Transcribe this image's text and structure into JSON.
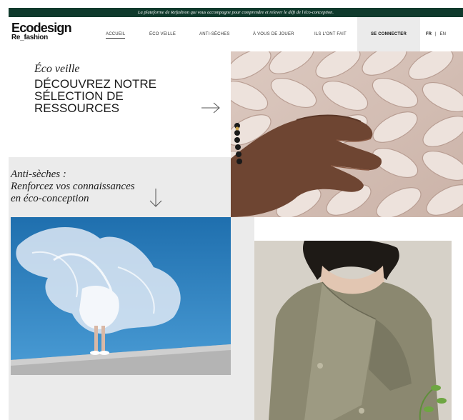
{
  "topbar": {
    "text": "La plateforme de Refashion qui vous accompagne pour comprendre et relever le défi de l'éco-conception."
  },
  "header": {
    "logo_main": "Ecodesign",
    "logo_sub": "Re_fashion",
    "nav": [
      {
        "label": "ACCUEIL",
        "active": true
      },
      {
        "label": "ÉCO VEILLE"
      },
      {
        "label": "ANTI-SÈCHES"
      },
      {
        "label": "À VOUS DE JOUER"
      },
      {
        "label": "ILS L'ONT FAIT"
      }
    ],
    "connect_label": "SE CONNECTER",
    "lang_fr": "FR",
    "lang_sep": "|",
    "lang_en": "EN"
  },
  "hero": {
    "title": "Éco veille",
    "subtitle": "DÉCOUVREZ NOTRE SÉLECTION DE RESSOURCES"
  },
  "anti": {
    "line1": "Anti-sèches :",
    "line2": "Renforcez vos connaissances",
    "line3": "en éco-conception"
  },
  "icons": {
    "arrow_right": "arrow-right-icon",
    "arrow_down": "arrow-down-icon"
  },
  "colors": {
    "topbar_bg": "#0f3a2c",
    "panel_gray": "#ebebeb",
    "text": "#1a1a1a"
  }
}
